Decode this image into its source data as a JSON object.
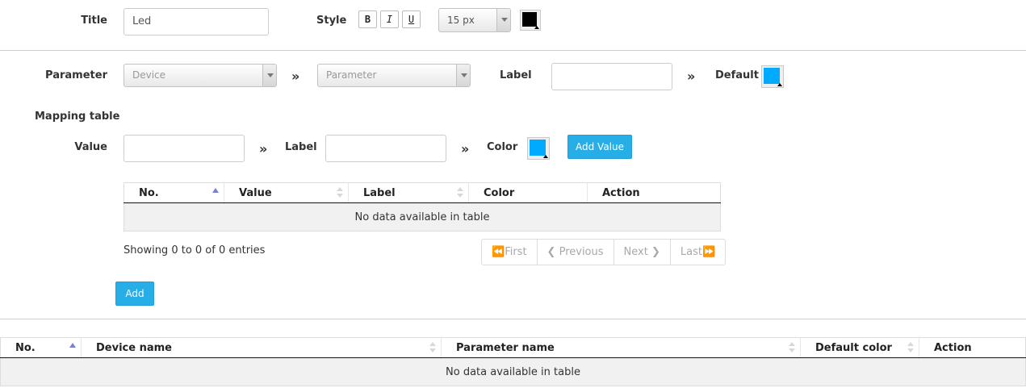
{
  "top": {
    "title_label": "Title",
    "title_value": "Led",
    "style_label": "Style",
    "bold": "B",
    "italic": "I",
    "underline": "U",
    "font_size": "15 px",
    "text_color": "#000000"
  },
  "parameter_row": {
    "label": "Parameter",
    "device_placeholder": "Device",
    "parameter_placeholder": "Parameter",
    "label_label": "Label",
    "label_value": "",
    "arrow": "»",
    "default_label": "Default",
    "default_color": "#00aaff"
  },
  "mapping": {
    "heading": "Mapping table",
    "value_label": "Value",
    "value_value": "",
    "label_label": "Label",
    "label_value": "",
    "color_label": "Color",
    "color": "#00aaff",
    "add_value_button": "Add Value",
    "table": {
      "columns": [
        "No.",
        "Value",
        "Label",
        "Color",
        "Action"
      ],
      "empty_text": "No data available in table"
    },
    "info": "Showing 0 to 0 of 0 entries",
    "pager": {
      "first": "First",
      "previous": "Previous",
      "next": "Next",
      "last": "Last"
    },
    "add_button": "Add"
  },
  "bottom_table": {
    "columns": [
      "No.",
      "Device name",
      "Parameter name",
      "Default color",
      "Action"
    ],
    "empty_text": "No data available in table"
  },
  "colors": {
    "accent": "#27aee6",
    "sort_active": "#7b7fd0"
  }
}
